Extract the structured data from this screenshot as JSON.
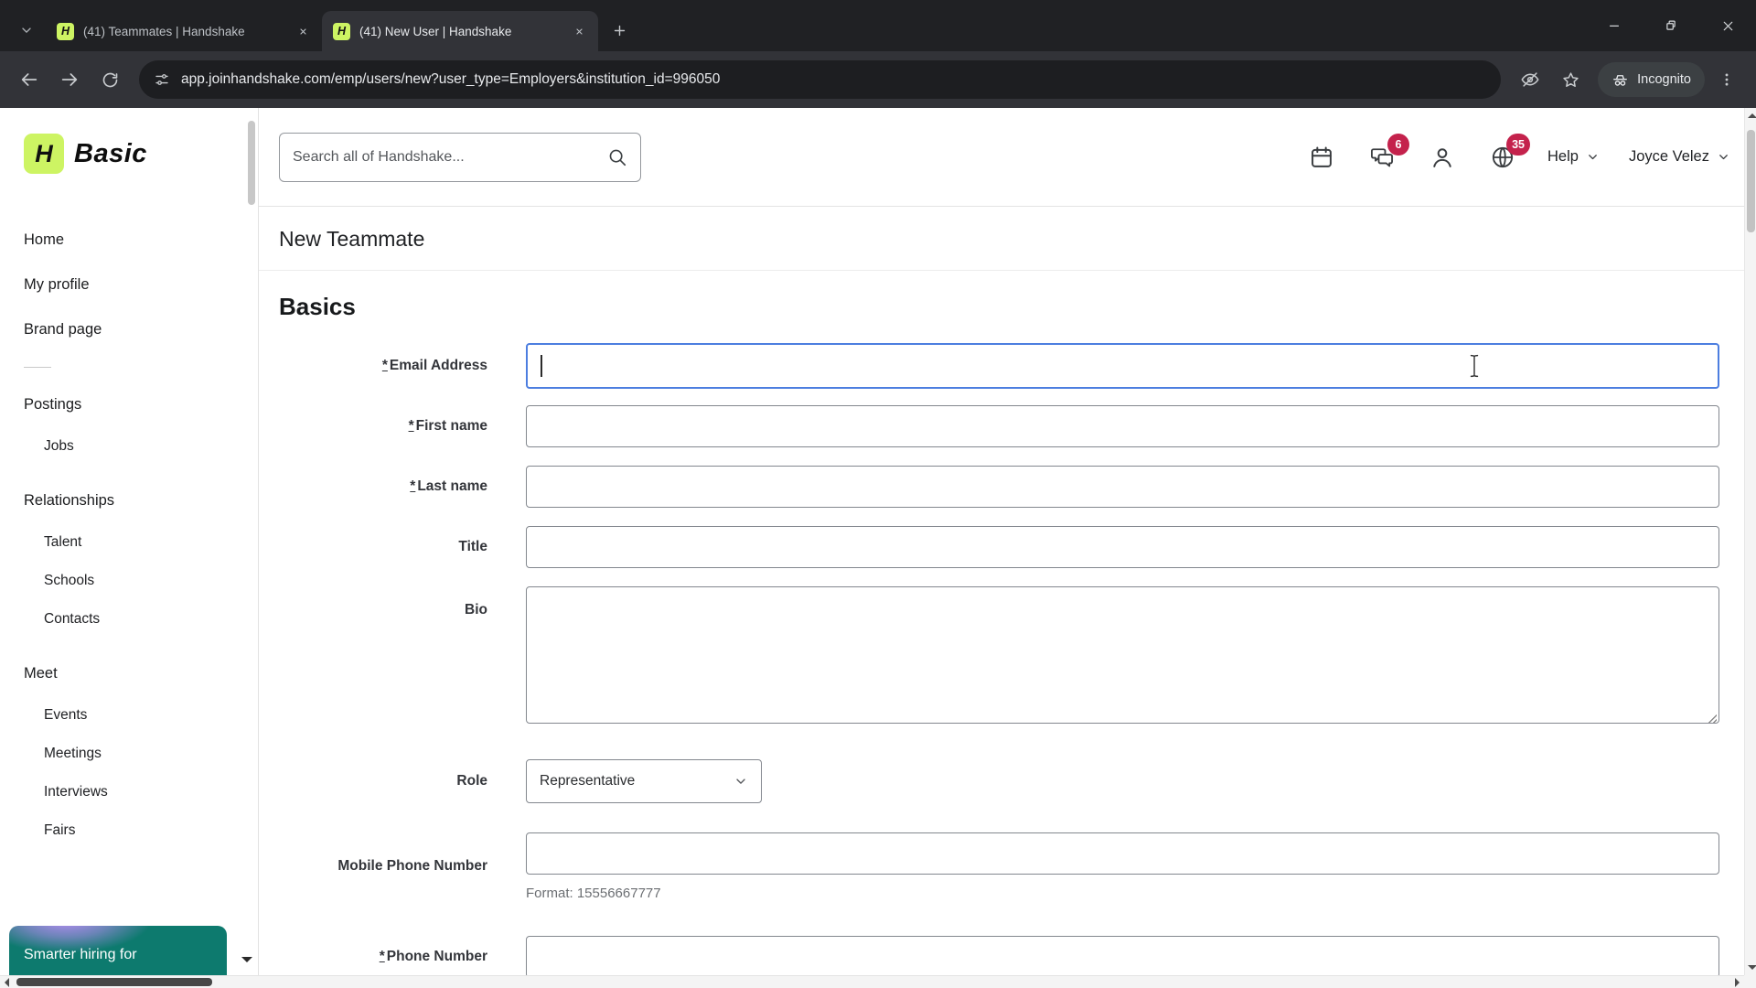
{
  "colors": {
    "brand_lime": "#cdf463",
    "badge_red": "#c4224c",
    "focus_blue": "#4c7ee0",
    "banner_teal": "#0d7a6e",
    "banner_purple": "#b68df2"
  },
  "browser": {
    "tabs": [
      {
        "title": "(41) Teammates | Handshake",
        "favicon_letter": "H"
      },
      {
        "title": "(41) New User | Handshake",
        "favicon_letter": "H"
      }
    ],
    "url": "app.joinhandshake.com/emp/users/new?user_type=Employers&institution_id=996050",
    "incognito_label": "Incognito"
  },
  "sidebar": {
    "logo_letter": "H",
    "logo_text": "Basic",
    "primary_items": [
      {
        "label": "Home"
      },
      {
        "label": "My profile"
      },
      {
        "label": "Brand page"
      }
    ],
    "sections": [
      {
        "label": "Postings",
        "items": [
          {
            "label": "Jobs"
          }
        ]
      },
      {
        "label": "Relationships",
        "items": [
          {
            "label": "Talent"
          },
          {
            "label": "Schools"
          },
          {
            "label": "Contacts"
          }
        ]
      },
      {
        "label": "Meet",
        "items": [
          {
            "label": "Events"
          },
          {
            "label": "Meetings"
          },
          {
            "label": "Interviews"
          },
          {
            "label": "Fairs"
          }
        ]
      }
    ],
    "banner_text": "Smarter hiring for"
  },
  "topbar": {
    "search_placeholder": "Search all of Handshake...",
    "messages_badge": "6",
    "notifications_badge": "35",
    "help_label": "Help",
    "user_name": "Joyce Velez"
  },
  "page": {
    "title": "New Teammate",
    "section_title": "Basics",
    "fields": {
      "email": {
        "marker": "*",
        "label": "Email Address"
      },
      "first": {
        "marker": "*",
        "label": "First name"
      },
      "last": {
        "marker": "*",
        "label": "Last name"
      },
      "title": {
        "marker": "",
        "label": "Title"
      },
      "bio": {
        "marker": "",
        "label": "Bio"
      },
      "role": {
        "marker": "",
        "label": "Role",
        "value": "Representative"
      },
      "mobile": {
        "marker": "",
        "label": "Mobile Phone Number",
        "helper": "Format: 15556667777"
      },
      "phone": {
        "marker": "*",
        "label": "Phone Number"
      }
    }
  }
}
